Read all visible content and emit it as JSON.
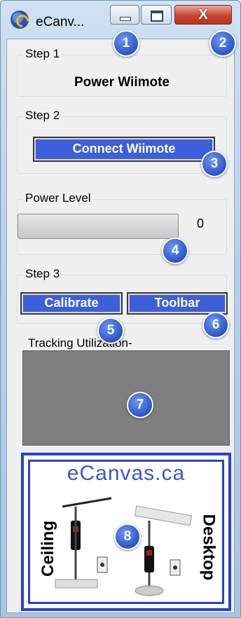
{
  "window": {
    "title": "eCanv...",
    "close_glyph": "X"
  },
  "step1": {
    "legend": "Step 1",
    "power_label": "Power Wiimote"
  },
  "step2": {
    "legend": "Step 2",
    "connect_label": "Connect Wiimote"
  },
  "power": {
    "legend": "Power Level",
    "value_text": "0",
    "level": 0
  },
  "step3": {
    "legend": "Step 3",
    "calibrate_label": "Calibrate",
    "toolbar_label": "Toolbar"
  },
  "tracking": {
    "label": "Tracking Utilization-"
  },
  "logo": {
    "brand": "eCanvas.ca",
    "left_label": "Ceiling",
    "right_label": "Desktop"
  },
  "badges": [
    "1",
    "2",
    "3",
    "4",
    "5",
    "6",
    "7",
    "8"
  ],
  "colors": {
    "button_blue": "#3d5fd9",
    "badge_blue": "#2a55c7",
    "logo_blue": "#2a43c9",
    "tracking_gray": "#7f7f7f"
  }
}
